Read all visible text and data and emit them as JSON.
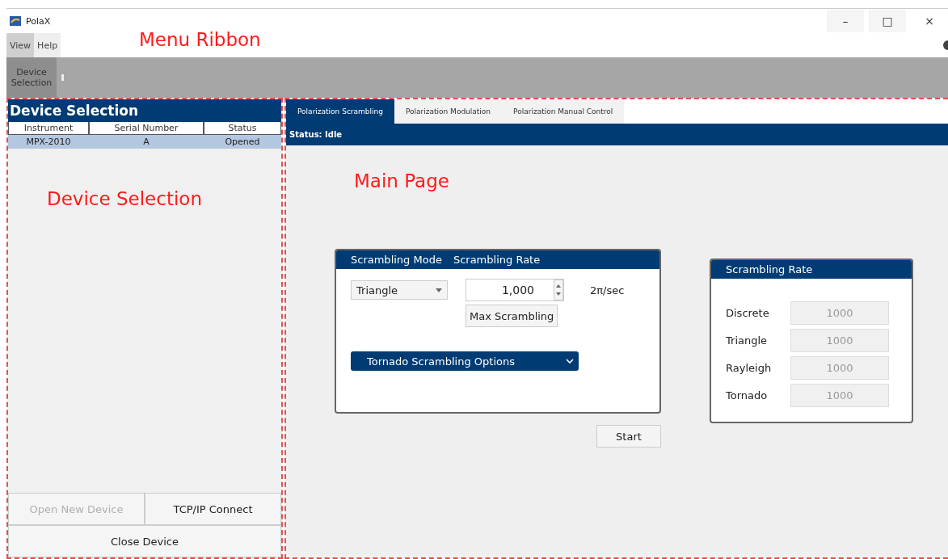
{
  "window": {
    "title": "PolaX",
    "controls": [
      "–",
      "□",
      "×"
    ]
  },
  "menu": [
    {
      "label": "View",
      "selected": true
    },
    {
      "label": "Help",
      "selected": false
    }
  ],
  "ribbon": {
    "buttons": [
      {
        "label": "Device Selection",
        "selected": true
      }
    ]
  },
  "annotations": [
    {
      "kind": "ribbon",
      "text": "Menu Ribbon"
    },
    {
      "kind": "sidebar",
      "text": "Device Selection"
    },
    {
      "kind": "main",
      "text": "Main Page"
    }
  ],
  "device_panel": {
    "title": "Device Selection",
    "columns": [
      "Instrument",
      "Serial Number",
      "Status"
    ],
    "rows": [
      {
        "cells": [
          "MPX-2010",
          "A",
          "Opened"
        ],
        "selected": true
      }
    ],
    "buttons": [
      {
        "label": "Open New Device",
        "disabled": true
      },
      {
        "label": "TCP/IP Connect",
        "disabled": false
      },
      {
        "label": "Close Device",
        "disabled": false
      }
    ]
  },
  "tabs": [
    {
      "label": "Polarization Scrambling",
      "selected": true
    },
    {
      "label": "Polarization Modulation",
      "selected": false
    },
    {
      "label": "Polarization Manual Control",
      "selected": false
    }
  ],
  "status": "Status: Idle",
  "scrambling": {
    "headers": [
      "Scrambling Mode",
      "Scrambling Rate"
    ],
    "mode": "Triangle",
    "rate": "1,000",
    "unit": "2π/sec",
    "max_button": "Max Scrambling",
    "options": "Tornado Scrambling Options",
    "start": "Start"
  },
  "rates": {
    "title": "Scrambling Rate",
    "rows": [
      {
        "label": "Discrete",
        "value": "1000"
      },
      {
        "label": "Triangle",
        "value": "1000"
      },
      {
        "label": "Rayleigh",
        "value": "1000"
      },
      {
        "label": "Tornado",
        "value": "1000"
      }
    ]
  }
}
